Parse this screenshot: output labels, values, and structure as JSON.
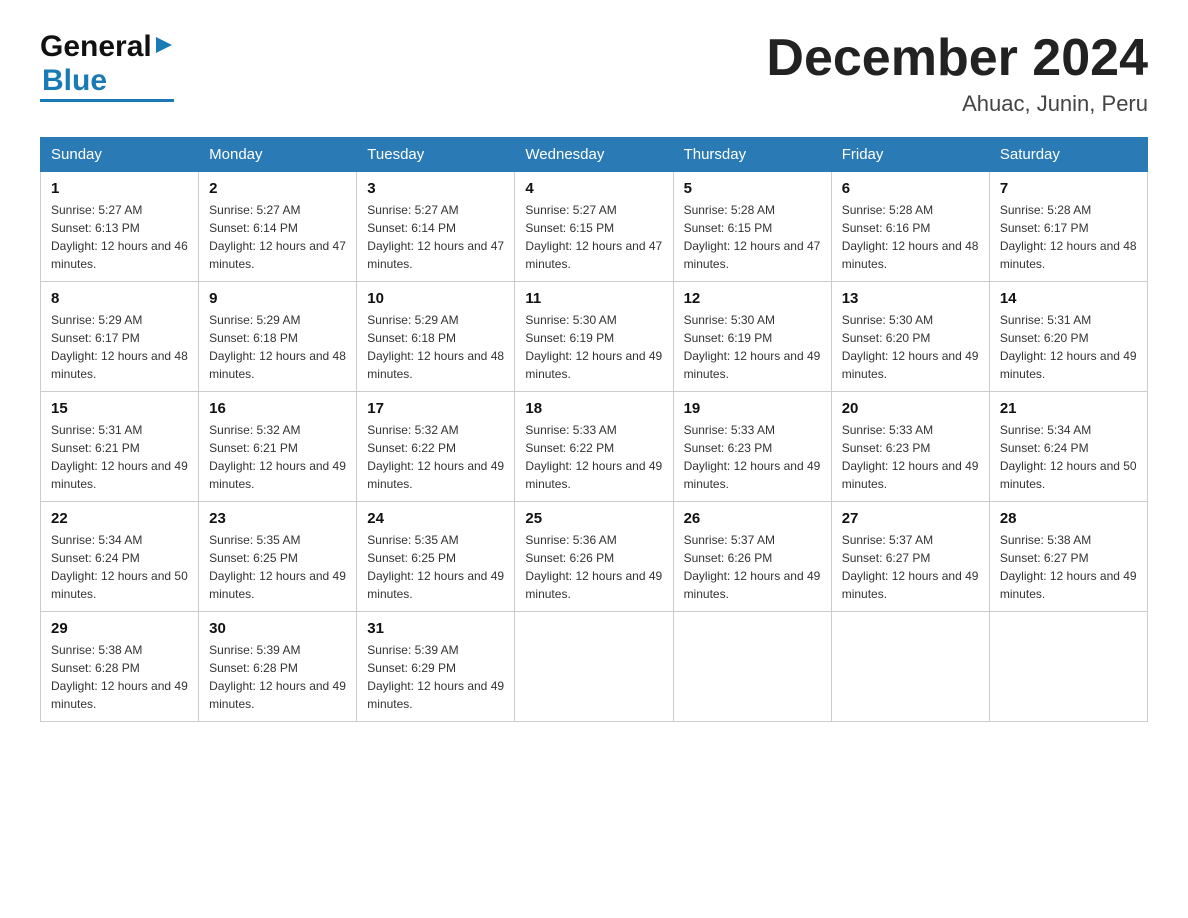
{
  "header": {
    "logo_general": "General",
    "logo_blue": "Blue",
    "month_title": "December 2024",
    "location": "Ahuac, Junin, Peru"
  },
  "days_of_week": [
    "Sunday",
    "Monday",
    "Tuesday",
    "Wednesday",
    "Thursday",
    "Friday",
    "Saturday"
  ],
  "weeks": [
    [
      {
        "day": "1",
        "sunrise": "5:27 AM",
        "sunset": "6:13 PM",
        "daylight": "12 hours and 46 minutes."
      },
      {
        "day": "2",
        "sunrise": "5:27 AM",
        "sunset": "6:14 PM",
        "daylight": "12 hours and 47 minutes."
      },
      {
        "day": "3",
        "sunrise": "5:27 AM",
        "sunset": "6:14 PM",
        "daylight": "12 hours and 47 minutes."
      },
      {
        "day": "4",
        "sunrise": "5:27 AM",
        "sunset": "6:15 PM",
        "daylight": "12 hours and 47 minutes."
      },
      {
        "day": "5",
        "sunrise": "5:28 AM",
        "sunset": "6:15 PM",
        "daylight": "12 hours and 47 minutes."
      },
      {
        "day": "6",
        "sunrise": "5:28 AM",
        "sunset": "6:16 PM",
        "daylight": "12 hours and 48 minutes."
      },
      {
        "day": "7",
        "sunrise": "5:28 AM",
        "sunset": "6:17 PM",
        "daylight": "12 hours and 48 minutes."
      }
    ],
    [
      {
        "day": "8",
        "sunrise": "5:29 AM",
        "sunset": "6:17 PM",
        "daylight": "12 hours and 48 minutes."
      },
      {
        "day": "9",
        "sunrise": "5:29 AM",
        "sunset": "6:18 PM",
        "daylight": "12 hours and 48 minutes."
      },
      {
        "day": "10",
        "sunrise": "5:29 AM",
        "sunset": "6:18 PM",
        "daylight": "12 hours and 48 minutes."
      },
      {
        "day": "11",
        "sunrise": "5:30 AM",
        "sunset": "6:19 PM",
        "daylight": "12 hours and 49 minutes."
      },
      {
        "day": "12",
        "sunrise": "5:30 AM",
        "sunset": "6:19 PM",
        "daylight": "12 hours and 49 minutes."
      },
      {
        "day": "13",
        "sunrise": "5:30 AM",
        "sunset": "6:20 PM",
        "daylight": "12 hours and 49 minutes."
      },
      {
        "day": "14",
        "sunrise": "5:31 AM",
        "sunset": "6:20 PM",
        "daylight": "12 hours and 49 minutes."
      }
    ],
    [
      {
        "day": "15",
        "sunrise": "5:31 AM",
        "sunset": "6:21 PM",
        "daylight": "12 hours and 49 minutes."
      },
      {
        "day": "16",
        "sunrise": "5:32 AM",
        "sunset": "6:21 PM",
        "daylight": "12 hours and 49 minutes."
      },
      {
        "day": "17",
        "sunrise": "5:32 AM",
        "sunset": "6:22 PM",
        "daylight": "12 hours and 49 minutes."
      },
      {
        "day": "18",
        "sunrise": "5:33 AM",
        "sunset": "6:22 PM",
        "daylight": "12 hours and 49 minutes."
      },
      {
        "day": "19",
        "sunrise": "5:33 AM",
        "sunset": "6:23 PM",
        "daylight": "12 hours and 49 minutes."
      },
      {
        "day": "20",
        "sunrise": "5:33 AM",
        "sunset": "6:23 PM",
        "daylight": "12 hours and 49 minutes."
      },
      {
        "day": "21",
        "sunrise": "5:34 AM",
        "sunset": "6:24 PM",
        "daylight": "12 hours and 50 minutes."
      }
    ],
    [
      {
        "day": "22",
        "sunrise": "5:34 AM",
        "sunset": "6:24 PM",
        "daylight": "12 hours and 50 minutes."
      },
      {
        "day": "23",
        "sunrise": "5:35 AM",
        "sunset": "6:25 PM",
        "daylight": "12 hours and 49 minutes."
      },
      {
        "day": "24",
        "sunrise": "5:35 AM",
        "sunset": "6:25 PM",
        "daylight": "12 hours and 49 minutes."
      },
      {
        "day": "25",
        "sunrise": "5:36 AM",
        "sunset": "6:26 PM",
        "daylight": "12 hours and 49 minutes."
      },
      {
        "day": "26",
        "sunrise": "5:37 AM",
        "sunset": "6:26 PM",
        "daylight": "12 hours and 49 minutes."
      },
      {
        "day": "27",
        "sunrise": "5:37 AM",
        "sunset": "6:27 PM",
        "daylight": "12 hours and 49 minutes."
      },
      {
        "day": "28",
        "sunrise": "5:38 AM",
        "sunset": "6:27 PM",
        "daylight": "12 hours and 49 minutes."
      }
    ],
    [
      {
        "day": "29",
        "sunrise": "5:38 AM",
        "sunset": "6:28 PM",
        "daylight": "12 hours and 49 minutes."
      },
      {
        "day": "30",
        "sunrise": "5:39 AM",
        "sunset": "6:28 PM",
        "daylight": "12 hours and 49 minutes."
      },
      {
        "day": "31",
        "sunrise": "5:39 AM",
        "sunset": "6:29 PM",
        "daylight": "12 hours and 49 minutes."
      },
      null,
      null,
      null,
      null
    ]
  ]
}
